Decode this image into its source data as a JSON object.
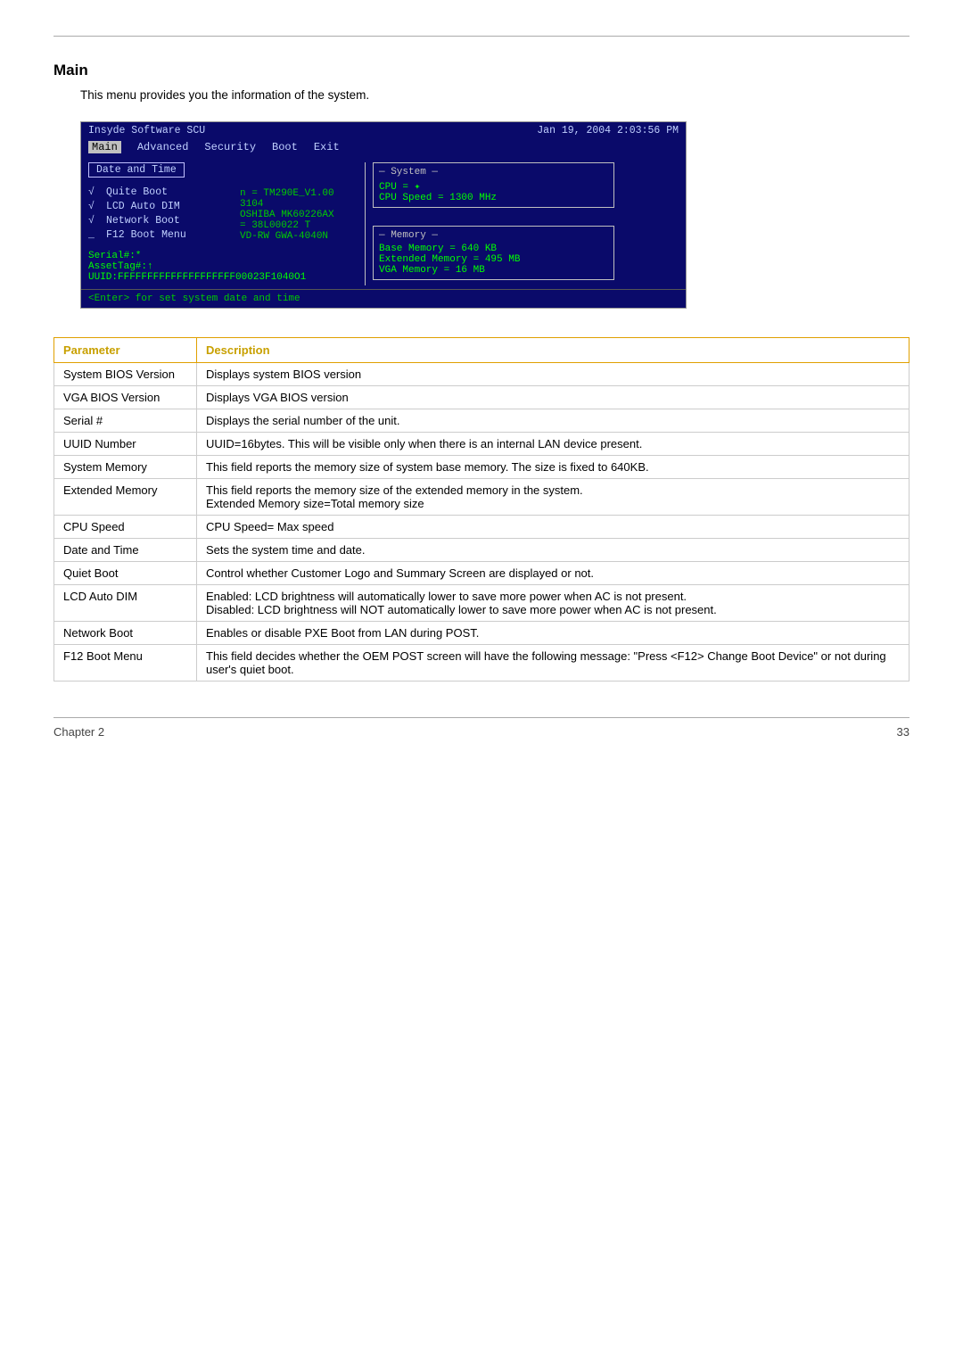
{
  "page": {
    "top_rule": true,
    "section_title": "Main",
    "section_intro": "This menu provides you the information of the system."
  },
  "bios": {
    "topbar": {
      "left": "Insyde Software SCU",
      "right": "Jan 19, 2004   2:03:56   PM"
    },
    "menubar": [
      {
        "label": "Main",
        "active": true
      },
      {
        "label": "Advanced",
        "active": false
      },
      {
        "label": "Security",
        "active": false
      },
      {
        "label": "Boot",
        "active": false
      },
      {
        "label": "Exit",
        "active": false
      }
    ],
    "left_panel": {
      "date_box": "Date and Time",
      "items": [
        {
          "check": "√",
          "label": "Quite Boot"
        },
        {
          "check": "√",
          "label": "LCD Auto DIM"
        },
        {
          "check": "√",
          "label": "Network Boot"
        },
        {
          "check": "_",
          "label": "F12 Boot Menu"
        }
      ],
      "sub_info": [
        "n = TM290E_V1.00",
        "3104",
        "OSHIBA MK60226AX",
        "= 38L00022 T",
        "VD-RW GWA-4040N"
      ],
      "serial_section": {
        "serial": "Serial#:*",
        "asset": "AssetTag#:↑",
        "uuid": "UUID:FFFFFFFFFFFFFFFFFFFF00023F1040O1"
      }
    },
    "right_panel": {
      "system_box": {
        "title": "System",
        "cpu": "CPU = ✦",
        "cpu_speed": "CPU Speed = 1300 MHz"
      },
      "memory_box": {
        "title": "Memory",
        "base": "Base Memory = 640 KB",
        "extended": "Extended Memory =  495 MB",
        "vga": "VGA Memory =   16 MB"
      }
    },
    "status_bar": "<Enter> for set system date and time"
  },
  "table": {
    "headers": [
      "Parameter",
      "Description"
    ],
    "rows": [
      {
        "param": "System BIOS Version",
        "desc": "Displays system BIOS version"
      },
      {
        "param": "VGA BIOS Version",
        "desc": "Displays VGA BIOS version"
      },
      {
        "param": "Serial #",
        "desc": "Displays the serial number of the unit."
      },
      {
        "param": "UUID Number",
        "desc": "UUID=16bytes. This will be visible only when there is an internal LAN device present."
      },
      {
        "param": "System Memory",
        "desc": "This field reports the memory size of system base memory. The size is fixed to 640KB."
      },
      {
        "param": "Extended Memory",
        "desc": "This field reports the memory size of the extended memory in the system.\nExtended Memory size=Total memory size"
      },
      {
        "param": "CPU Speed",
        "desc": "CPU Speed= Max speed"
      },
      {
        "param": "Date and Time",
        "desc": "Sets the system time and date."
      },
      {
        "param": "Quiet Boot",
        "desc": "Control whether Customer Logo and Summary Screen are displayed or not."
      },
      {
        "param": "LCD Auto DIM",
        "desc": "Enabled: LCD brightness will automatically lower to save more power when AC is not present.\nDisabled: LCD brightness will NOT automatically lower to save more power when AC is not present."
      },
      {
        "param": "Network Boot",
        "desc": "Enables or disable PXE Boot from LAN during POST."
      },
      {
        "param": "F12 Boot Menu",
        "desc": "This field decides whether the OEM POST screen will have the following message: \"Press <F12> Change Boot Device\" or not during user's quiet boot."
      }
    ]
  },
  "footer": {
    "left": "Chapter 2",
    "right": "33"
  }
}
